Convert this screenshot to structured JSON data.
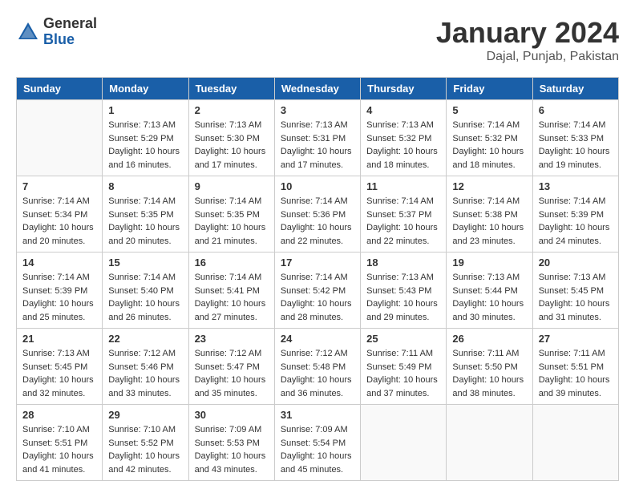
{
  "logo": {
    "general": "General",
    "blue": "Blue"
  },
  "title": "January 2024",
  "subtitle": "Dajal, Punjab, Pakistan",
  "days_of_week": [
    "Sunday",
    "Monday",
    "Tuesday",
    "Wednesday",
    "Thursday",
    "Friday",
    "Saturday"
  ],
  "weeks": [
    [
      {
        "day": "",
        "info": ""
      },
      {
        "day": "1",
        "info": "Sunrise: 7:13 AM\nSunset: 5:29 PM\nDaylight: 10 hours\nand 16 minutes."
      },
      {
        "day": "2",
        "info": "Sunrise: 7:13 AM\nSunset: 5:30 PM\nDaylight: 10 hours\nand 17 minutes."
      },
      {
        "day": "3",
        "info": "Sunrise: 7:13 AM\nSunset: 5:31 PM\nDaylight: 10 hours\nand 17 minutes."
      },
      {
        "day": "4",
        "info": "Sunrise: 7:13 AM\nSunset: 5:32 PM\nDaylight: 10 hours\nand 18 minutes."
      },
      {
        "day": "5",
        "info": "Sunrise: 7:14 AM\nSunset: 5:32 PM\nDaylight: 10 hours\nand 18 minutes."
      },
      {
        "day": "6",
        "info": "Sunrise: 7:14 AM\nSunset: 5:33 PM\nDaylight: 10 hours\nand 19 minutes."
      }
    ],
    [
      {
        "day": "7",
        "info": "Sunrise: 7:14 AM\nSunset: 5:34 PM\nDaylight: 10 hours\nand 20 minutes."
      },
      {
        "day": "8",
        "info": "Sunrise: 7:14 AM\nSunset: 5:35 PM\nDaylight: 10 hours\nand 20 minutes."
      },
      {
        "day": "9",
        "info": "Sunrise: 7:14 AM\nSunset: 5:35 PM\nDaylight: 10 hours\nand 21 minutes."
      },
      {
        "day": "10",
        "info": "Sunrise: 7:14 AM\nSunset: 5:36 PM\nDaylight: 10 hours\nand 22 minutes."
      },
      {
        "day": "11",
        "info": "Sunrise: 7:14 AM\nSunset: 5:37 PM\nDaylight: 10 hours\nand 22 minutes."
      },
      {
        "day": "12",
        "info": "Sunrise: 7:14 AM\nSunset: 5:38 PM\nDaylight: 10 hours\nand 23 minutes."
      },
      {
        "day": "13",
        "info": "Sunrise: 7:14 AM\nSunset: 5:39 PM\nDaylight: 10 hours\nand 24 minutes."
      }
    ],
    [
      {
        "day": "14",
        "info": "Sunrise: 7:14 AM\nSunset: 5:39 PM\nDaylight: 10 hours\nand 25 minutes."
      },
      {
        "day": "15",
        "info": "Sunrise: 7:14 AM\nSunset: 5:40 PM\nDaylight: 10 hours\nand 26 minutes."
      },
      {
        "day": "16",
        "info": "Sunrise: 7:14 AM\nSunset: 5:41 PM\nDaylight: 10 hours\nand 27 minutes."
      },
      {
        "day": "17",
        "info": "Sunrise: 7:14 AM\nSunset: 5:42 PM\nDaylight: 10 hours\nand 28 minutes."
      },
      {
        "day": "18",
        "info": "Sunrise: 7:13 AM\nSunset: 5:43 PM\nDaylight: 10 hours\nand 29 minutes."
      },
      {
        "day": "19",
        "info": "Sunrise: 7:13 AM\nSunset: 5:44 PM\nDaylight: 10 hours\nand 30 minutes."
      },
      {
        "day": "20",
        "info": "Sunrise: 7:13 AM\nSunset: 5:45 PM\nDaylight: 10 hours\nand 31 minutes."
      }
    ],
    [
      {
        "day": "21",
        "info": "Sunrise: 7:13 AM\nSunset: 5:45 PM\nDaylight: 10 hours\nand 32 minutes."
      },
      {
        "day": "22",
        "info": "Sunrise: 7:12 AM\nSunset: 5:46 PM\nDaylight: 10 hours\nand 33 minutes."
      },
      {
        "day": "23",
        "info": "Sunrise: 7:12 AM\nSunset: 5:47 PM\nDaylight: 10 hours\nand 35 minutes."
      },
      {
        "day": "24",
        "info": "Sunrise: 7:12 AM\nSunset: 5:48 PM\nDaylight: 10 hours\nand 36 minutes."
      },
      {
        "day": "25",
        "info": "Sunrise: 7:11 AM\nSunset: 5:49 PM\nDaylight: 10 hours\nand 37 minutes."
      },
      {
        "day": "26",
        "info": "Sunrise: 7:11 AM\nSunset: 5:50 PM\nDaylight: 10 hours\nand 38 minutes."
      },
      {
        "day": "27",
        "info": "Sunrise: 7:11 AM\nSunset: 5:51 PM\nDaylight: 10 hours\nand 39 minutes."
      }
    ],
    [
      {
        "day": "28",
        "info": "Sunrise: 7:10 AM\nSunset: 5:51 PM\nDaylight: 10 hours\nand 41 minutes."
      },
      {
        "day": "29",
        "info": "Sunrise: 7:10 AM\nSunset: 5:52 PM\nDaylight: 10 hours\nand 42 minutes."
      },
      {
        "day": "30",
        "info": "Sunrise: 7:09 AM\nSunset: 5:53 PM\nDaylight: 10 hours\nand 43 minutes."
      },
      {
        "day": "31",
        "info": "Sunrise: 7:09 AM\nSunset: 5:54 PM\nDaylight: 10 hours\nand 45 minutes."
      },
      {
        "day": "",
        "info": ""
      },
      {
        "day": "",
        "info": ""
      },
      {
        "day": "",
        "info": ""
      }
    ]
  ]
}
